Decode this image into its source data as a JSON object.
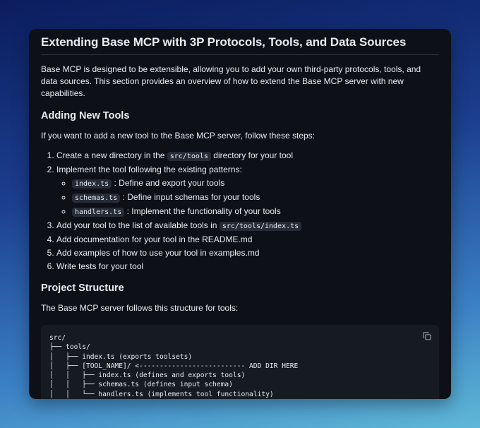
{
  "title": "Extending Base MCP with 3P Protocols, Tools, and Data Sources",
  "intro": "Base MCP is designed to be extensible, allowing you to add your own third-party protocols, tools, and data sources. This section provides an overview of how to extend the Base MCP server with new capabilities.",
  "section1": {
    "heading": "Adding New Tools",
    "lead": "If you want to add a new tool to the Base MCP server, follow these steps:",
    "step1": {
      "before": "Create a new directory in the ",
      "code": "src/tools",
      "after": " directory for your tool"
    },
    "step2": {
      "text": "Implement the tool following the existing patterns:",
      "sub": [
        {
          "code": "index.ts",
          "text": ": Define and export your tools"
        },
        {
          "code": "schemas.ts",
          "text": ": Define input schemas for your tools"
        },
        {
          "code": "handlers.ts",
          "text": ": Implement the functionality of your tools"
        }
      ]
    },
    "step3": {
      "before": "Add your tool to the list of available tools in ",
      "code": "src/tools/index.ts"
    },
    "step4": "Add documentation for your tool in the README.md",
    "step5": "Add examples of how to use your tool in examples.md",
    "step6": "Write tests for your tool"
  },
  "section2": {
    "heading": "Project Structure",
    "lead": "The Base MCP server follows this structure for tools:",
    "code": "src/\n├── tools/\n│   ├── index.ts (exports toolsets)\n│   ├── [TOOL_NAME]/ <-------------------------- ADD DIR HERE\n│   │   ├── index.ts (defines and exports tools)\n│   │   ├── schemas.ts (defines input schema)\n│   │   └── handlers.ts (implements tool functionality)\n│   └── utils/ (shared tool utilities)"
  },
  "icons": {
    "copy": "copy-icon"
  }
}
